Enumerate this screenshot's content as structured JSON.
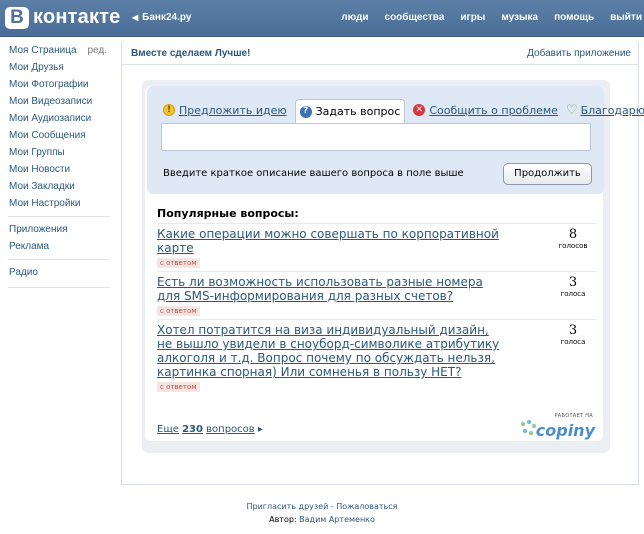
{
  "header": {
    "logo_letter": "B",
    "logo_text": "контакте",
    "back_link": "Банк24.ру",
    "nav": [
      "люди",
      "сообщества",
      "игры",
      "музыка",
      "помощь",
      "выйти"
    ]
  },
  "sidebar": {
    "edit_label": "ред.",
    "items": [
      "Моя Страница",
      "Мои Друзья",
      "Мои Фотографии",
      "Мои Видеозаписи",
      "Мои Аудиозаписи",
      "Мои Сообщения",
      "Мои Группы",
      "Мои Новости",
      "Мои Закладки",
      "Мои Настройки"
    ],
    "extra": [
      "Приложения",
      "Реклама"
    ],
    "radio": "Радио"
  },
  "app": {
    "title": "Вместе сделаем Лучше!",
    "add_app": "Добавить приложение"
  },
  "widget": {
    "tabs": [
      {
        "label": "Предложить идею",
        "icon": "lightbulb-icon"
      },
      {
        "label": "Задать вопрос",
        "icon": "question-icon"
      },
      {
        "label": "Сообщить о проблеме",
        "icon": "problem-icon"
      },
      {
        "label": "Благодарю",
        "icon": "heart-icon"
      }
    ],
    "input_value": "",
    "hint": "Введите краткое описание вашего вопроса в поле выше",
    "continue_label": "Продолжить",
    "popular_title": "Популярные вопросы:",
    "questions": [
      {
        "text": "Какие операции можно совершать по корпоративной карте",
        "badge": "с ответом",
        "votes": "8",
        "votes_label": "голосов"
      },
      {
        "text": "Есть ли возможность использовать разные номера для SMS-информирования для разных счетов?",
        "badge": "с ответом",
        "votes": "3",
        "votes_label": "голоса"
      },
      {
        "text": "Хотел потратится на виза индивидуальный дизайн, не вышло увидели в сноуборд-символике атрибутику алкоголя и т.д. Вопрос почему по обсуждать нельзя, картинка спорная) Или сомненья в пользу НЕТ?",
        "badge": "с ответом",
        "votes": "3",
        "votes_label": "голоса"
      }
    ],
    "more_prefix": "Еще",
    "more_count": "230",
    "more_suffix": "вопросов",
    "powered_small": "РАБОТАЕТ НА",
    "powered_brand": "copiny"
  },
  "footer": {
    "invite": "Пригласить друзей",
    "separator": "-",
    "complain": "Пожаловаться",
    "author_label": "Автор:",
    "author_name": "Вадим Артеменко"
  },
  "colors": {
    "header": "#4d72a0",
    "link": "#2b587a",
    "badge_text": "#c54a42",
    "panel": "#dfe9f6"
  }
}
